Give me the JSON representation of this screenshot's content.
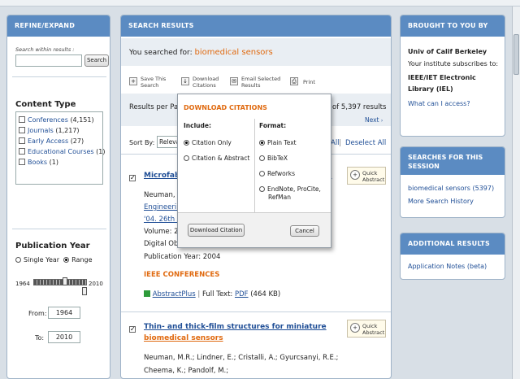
{
  "left": {
    "header": "REFINE/EXPAND RESULTS",
    "search_within_label": "Search within results :",
    "search_button": "Search",
    "content_type_title": "Content Type",
    "content_types": [
      {
        "label": "Conferences",
        "count": "(4,151)"
      },
      {
        "label": "Journals",
        "count": "(1,217)"
      },
      {
        "label": "Early Access",
        "count": "(27)"
      },
      {
        "label": "Educational Courses",
        "count": "(1)"
      },
      {
        "label": "Books",
        "count": "(1)"
      }
    ],
    "pub_year_title": "Publication Year",
    "single_year": "Single Year",
    "range": "Range",
    "year_min": "1964",
    "year_max": "2010",
    "from_label": "From:",
    "from_value": "1964",
    "to_label": "To:",
    "to_value": "2010"
  },
  "main": {
    "header": "SEARCH RESULTS",
    "you_searched": "You searched for:",
    "query": "biomedical sensors",
    "toolbar": {
      "save_line1": "Save This",
      "save_line2": "Search",
      "download_line1": "Download",
      "download_line2": "Citations",
      "email_line1": "Email Selected",
      "email_line2": "Results",
      "print": "Print"
    },
    "results_per_page_prefix": "Results per Pag",
    "results_of": "of 5,397 results",
    "next": "Next",
    "sort_by": "Sort By:",
    "sort_value": "Releva",
    "all": "All",
    "deselect_all": "Deselect All",
    "result1": {
      "title_prefix": "Microfab",
      "title_suffix": "s",
      "authors": "Neuman, M",
      "venue1": "Engineerin",
      "venue2": "'04. 26th A",
      "volume": "Volume: 2",
      "digital": "Digital Obj",
      "pub_year": "Publication Year: 2004",
      "category": "IEEE CONFERENCES",
      "abstractplus": "AbstractPlus",
      "full_text_label": "Full Text:",
      "pdf": "PDF",
      "pdf_size": "(464 KB)"
    },
    "result2": {
      "title1": "Thin- and thick-film structures for miniature",
      "title2": "biomedical sensors",
      "authors1": "Neuman, M.R.; Lindner, E.; Cristalli, A.; Gyurcsanyi, R.E.;",
      "authors2": "Cheema, K.; Pandolf, M.;"
    },
    "quick_abstract_line1": "Quick",
    "quick_abstract_line2": "Abstract"
  },
  "popup": {
    "title": "DOWNLOAD CITATIONS",
    "include_label": "Include:",
    "format_label": "Format:",
    "include_options": [
      "Citation Only",
      "Citation & Abstract"
    ],
    "format_options": [
      "Plain Text",
      "BibTeX",
      "Refworks",
      "EndNote, ProCite,",
      "RefMan"
    ],
    "download_button": "Download Citation",
    "cancel_button": "Cancel"
  },
  "right": {
    "brought_header": "BROUGHT TO YOU BY",
    "institution": "Univ of Calif Berkeley",
    "subscribes": "Your institute subscribes to:",
    "library1": "IEEE/IET Electronic",
    "library2": "Library (IEL)",
    "access_link": "What can I access?",
    "searches_header1": "SEARCHES FOR THIS",
    "searches_header2": "SESSION",
    "session_search": "biomedical sensors (5397)",
    "more_history": "More Search History",
    "additional_header": "ADDITIONAL RESULTS",
    "app_notes": "Application Notes (beta)"
  },
  "colors": {
    "header_blue": "#5b8bc2",
    "accent_orange": "#e06a10",
    "link_blue": "#1f4e96"
  }
}
